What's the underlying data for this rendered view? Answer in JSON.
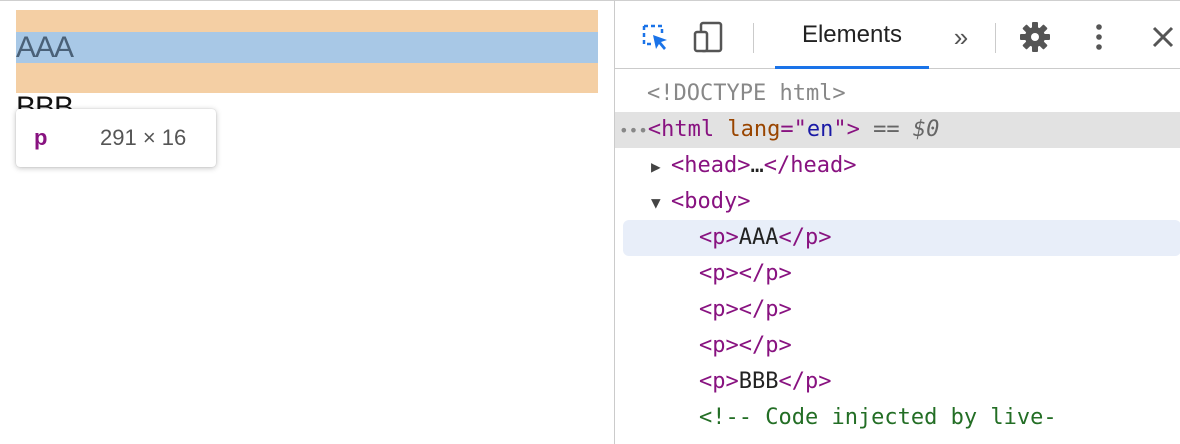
{
  "viewport": {
    "paragraph_aaa": "AAA",
    "paragraph_bbb": "BBB"
  },
  "tooltip": {
    "tag": "p",
    "dims": "291 × 16"
  },
  "devtools": {
    "tabs": {
      "elements": "Elements",
      "more": "»"
    },
    "tree": {
      "doctype": "<!DOCTYPE html>",
      "html_open": "<html",
      "html_attr": "lang",
      "html_eq": "=\"",
      "html_val": "en",
      "html_close": "\">",
      "selected_marker": "== $0",
      "ellipsis_dots": "•••",
      "head_open": "<head>",
      "head_ellipsis": "…",
      "head_close": "</head>",
      "body_open": "<body>",
      "p_open": "<p>",
      "p_close": "</p>",
      "p1_text": "AAA",
      "p5_text": "BBB",
      "comment": "<!-- Code injected by live-"
    }
  },
  "colors": {
    "margin": "#f4cfa4",
    "content": "#a8c8e6",
    "accent": "#1a73e8",
    "tag": "#881280"
  },
  "icons": [
    "inspect-element-icon",
    "device-toggle-icon",
    "settings-gear-icon",
    "kebab-menu-icon",
    "close-icon"
  ]
}
